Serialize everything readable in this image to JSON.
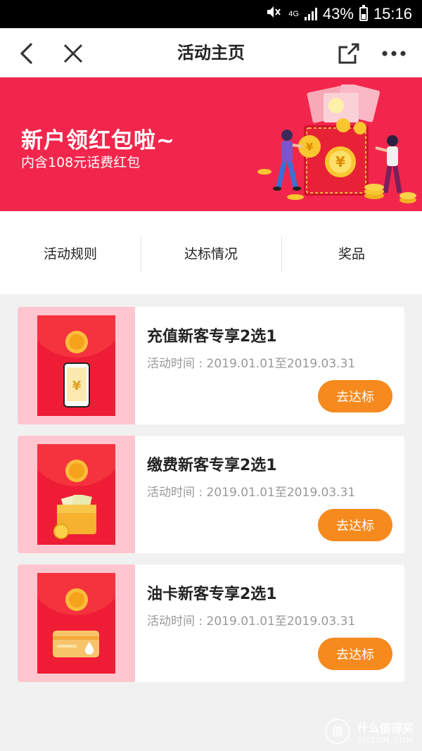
{
  "status_bar": {
    "network": "4G",
    "battery": "43%",
    "time": "15:16"
  },
  "nav": {
    "title": "活动主页"
  },
  "banner": {
    "title": "新户领红包啦~",
    "subtitle": "内含108元话费红包"
  },
  "tabs": [
    {
      "label": "活动规则"
    },
    {
      "label": "达标情况"
    },
    {
      "label": "奖品"
    }
  ],
  "cards": [
    {
      "title": "充值新客专享2选1",
      "time": "活动时间 : 2019.01.01至2019.03.31",
      "button": "去达标",
      "icon": "phone-yuan-icon"
    },
    {
      "title": "缴费新客专享2选1",
      "time": "活动时间 : 2019.01.01至2019.03.31",
      "button": "去达标",
      "icon": "wallet-icon"
    },
    {
      "title": "油卡新客专享2选1",
      "time": "活动时间 : 2019.01.01至2019.03.31",
      "button": "去达标",
      "icon": "fuel-card-icon"
    }
  ],
  "watermark": {
    "line1": "什么值得买",
    "line2": "SMZDM.COM"
  },
  "colors": {
    "banner": "#f2264c",
    "button": "#f68a1e",
    "envelope": "#ee1d35"
  }
}
